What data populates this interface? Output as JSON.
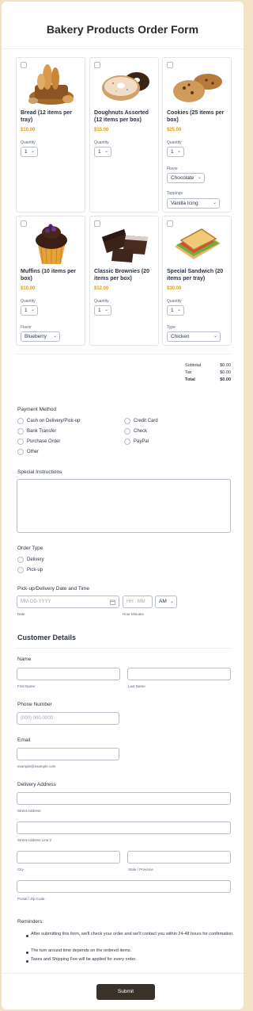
{
  "form": {
    "title": "Bakery Products Order Form",
    "quantity_label": "Quantity",
    "products": [
      {
        "name": "Bread (12 items per tray)",
        "price": "$10.00",
        "quantity": "1"
      },
      {
        "name": "Doughnuts Assorted (12 items per box)",
        "price": "$15.00",
        "quantity": "1"
      },
      {
        "name": "Cookies (25 items per box)",
        "price": "$25.00",
        "quantity": "1",
        "option1_label": "Flavor",
        "option1_value": "Chocolate",
        "option2_label": "Toppings",
        "option2_value": "Vanilla Icing"
      },
      {
        "name": "Muffins (10 items per box)",
        "price": "$10.00",
        "quantity": "1",
        "option1_label": "Flavor",
        "option1_value": "Blueberry"
      },
      {
        "name": "Classic Brownies (20 items per box)",
        "price": "$12.00",
        "quantity": "1"
      },
      {
        "name": "Special Sandwich (20 items per tray)",
        "price": "$30.00",
        "quantity": "1",
        "option1_label": "Type",
        "option1_value": "Chicken"
      }
    ],
    "totals": {
      "subtotal_label": "Subtotal",
      "subtotal_value": "$0.00",
      "tax_label": "Tax",
      "tax_value": "$0.00",
      "total_label": "Total",
      "total_value": "$0.00"
    },
    "payment": {
      "label": "Payment Method",
      "options": [
        "Cash on Delivery/Pick-up",
        "Bank Transfer",
        "Purchase Order",
        "Other",
        "Credit Card",
        "Check",
        "PayPal"
      ]
    },
    "special_instructions": {
      "label": "Special Instructions"
    },
    "order_type": {
      "label": "Order Type",
      "options": [
        "Delivery",
        "Pick-up"
      ]
    },
    "datetime": {
      "label": "Pick-up/Delivery Date and Time",
      "date_placeholder": "MM-DD-YYYY",
      "time_placeholder": "HH : MM",
      "ampm": "AM",
      "date_sub": "Date",
      "time_sub": "Hour Minutes"
    },
    "customer": {
      "heading": "Customer Details",
      "name_label": "Name",
      "first_sub": "First Name",
      "last_sub": "Last Name",
      "phone_label": "Phone Number",
      "phone_placeholder": "(000) 000-0000",
      "email_label": "Email",
      "email_sub": "example@example.com",
      "address_label": "Delivery Address",
      "street_sub": "Street Address",
      "street2_sub": "Street Address Line 2",
      "city_sub": "City",
      "state_sub": "State / Province",
      "zip_sub": "Postal / Zip Code"
    },
    "reminders": {
      "label": "Reminders:",
      "items": [
        "After submitting this form, we'll check your order and we'll contact you within 24-48 hours for confirmation.",
        "The turn around time depends on the ordered items.",
        "Taxes and Shipping Fee will be applied for every order."
      ]
    },
    "submit_label": "Submit"
  },
  "colors": {
    "accent": "#e59a14",
    "button": "#3a3128",
    "frame": "#f3e3c6"
  }
}
